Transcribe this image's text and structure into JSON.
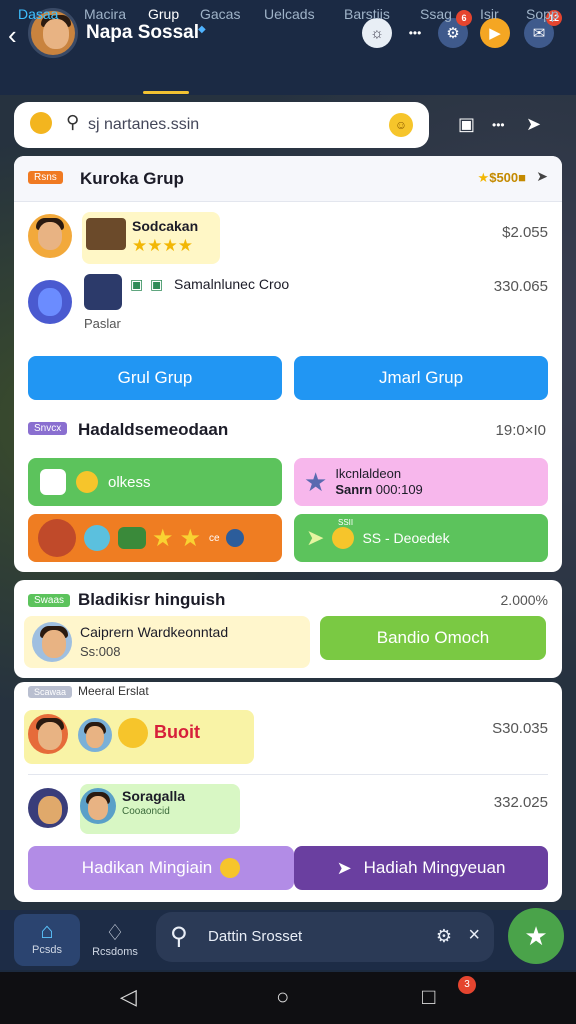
{
  "header": {
    "title": "Napa Sossal",
    "notif_badge": "6",
    "msg_badge": "12",
    "tabs": [
      "Dasaa",
      "Macira",
      "Grup",
      "Gacas",
      "Uelcads",
      "Barstiis",
      "Ssag",
      "Isir",
      "Sopp"
    ]
  },
  "search": {
    "value": "sj nartanes.ssin"
  },
  "card1": {
    "tag": "Rsns",
    "title": "Kuroka Grup",
    "coins": "500",
    "row1": {
      "name": "Sodcakan",
      "price": "$2.055"
    },
    "row2": {
      "name": "Samalnlunec Croo",
      "sub": "Paslar",
      "price": "330.065"
    },
    "btn_left": "Grul Grup",
    "btn_right": "Jmarl Grup",
    "section_tag": "Snvcx",
    "section_title": "Hadaldsemeodaan",
    "section_value": "19:0×I0",
    "tile_green": "olkess",
    "tile_pink_line1": "Ikcnlaldeon",
    "tile_pink_line2": "Sanrn",
    "tile_pink_value": "000:109",
    "tile_green2_sub": "SSII",
    "tile_green2_label": "SS - Deoedek",
    "tile_orange_sub": "ce"
  },
  "card2": {
    "tag": "Swaas",
    "title": "Bladikisr hinguish",
    "value": "2.000%",
    "name": "Caiprern Wardkeonntad",
    "amount": "Ss:008",
    "button": "Bandio Omoch"
  },
  "card3": {
    "tag": "Scawaa",
    "title": "Meeral Erslat",
    "row1_label": "Buoit",
    "row1_price": "S30.035",
    "row2_name": "Soragalla",
    "row2_sub": "Cooaoncid",
    "row2_price": "332.025",
    "btn_left": "Hadikan Mingiain",
    "btn_right": "Hadiah Mingyeuan"
  },
  "bottom": {
    "nav1": "Pcsds",
    "nav2": "Rcsdoms",
    "search": "Dattin Srosset"
  },
  "system": {
    "badge": "3"
  },
  "colors": {
    "blue": "#2196f3",
    "green": "#7ac943",
    "purple": "#6a3fa0",
    "orange": "#ef7d22"
  }
}
